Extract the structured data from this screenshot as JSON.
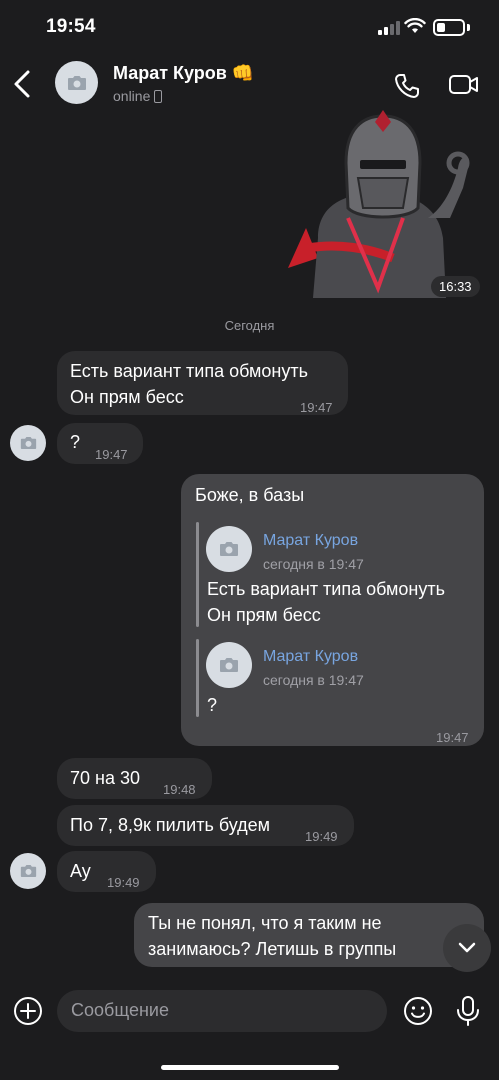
{
  "status_bar": {
    "time": "19:54"
  },
  "header": {
    "back_icon": "chevron-left-icon",
    "contact_name": "Марат Куров 👊",
    "contact_status": "online",
    "call_icon": "phone-icon",
    "video_icon": "video-camera-icon"
  },
  "sticker": {
    "time": "16:33"
  },
  "date_separator": "Сегодня",
  "messages": [
    {
      "direction": "in",
      "lines": [
        "Есть вариант типа обмонуть",
        "Он прям бесс"
      ],
      "time": "19:47"
    },
    {
      "direction": "in",
      "lines": [
        "?"
      ],
      "time": "19:47"
    },
    {
      "direction": "out",
      "text": "Боже, в базы",
      "time": "19:47",
      "replies": [
        {
          "author": "Марат Куров",
          "when": "сегодня в 19:47",
          "lines": [
            "Есть вариант типа обмонуть",
            "Он прям бесс"
          ]
        },
        {
          "author": "Марат Куров",
          "when": "сегодня в 19:47",
          "lines": [
            "?"
          ]
        }
      ]
    },
    {
      "direction": "in",
      "lines": [
        "70 на 30"
      ],
      "time": "19:48"
    },
    {
      "direction": "in",
      "lines": [
        "По 7, 8,9к пилить будем"
      ],
      "time": "19:49"
    },
    {
      "direction": "in",
      "lines": [
        "Ау"
      ],
      "time": "19:49"
    },
    {
      "direction": "out",
      "lines": [
        "Ты не понял, что я таким не",
        "занимаюсь? Летишь в группы"
      ],
      "time": ""
    }
  ],
  "composer": {
    "placeholder": "Сообщение",
    "add_icon": "plus-circle-icon",
    "emoji_icon": "smile-icon",
    "mic_icon": "microphone-icon"
  }
}
